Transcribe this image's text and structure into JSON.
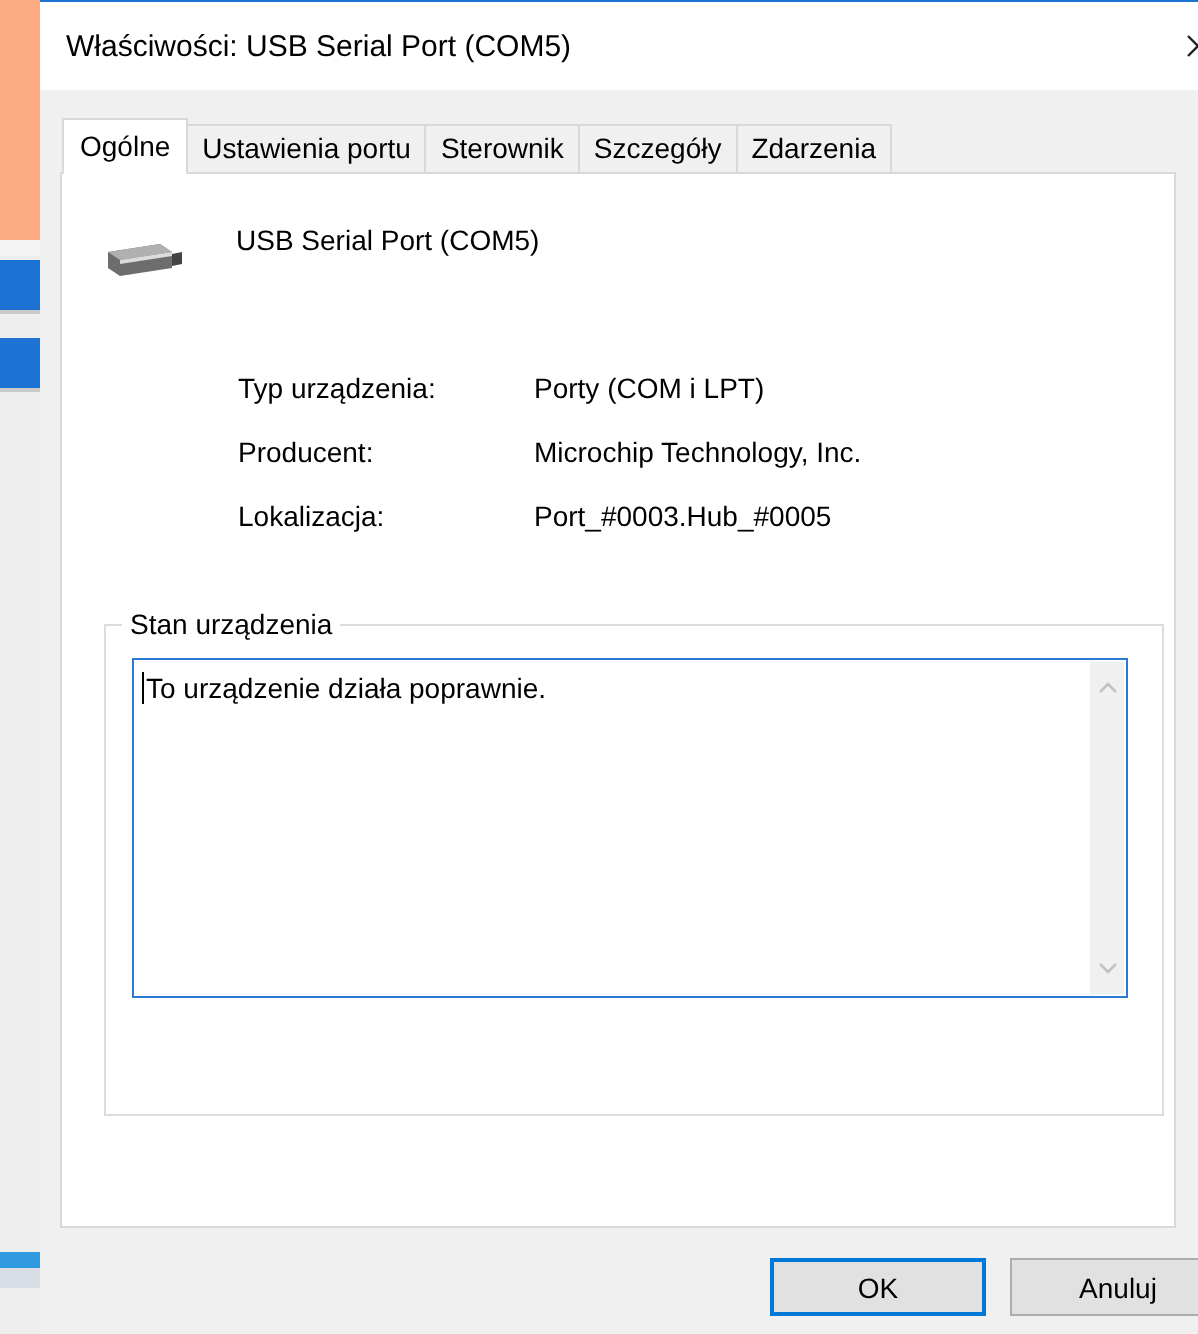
{
  "window": {
    "title": "Właściwości: USB Serial Port (COM5)"
  },
  "tabs": [
    {
      "label": "Ogólne",
      "selected": true
    },
    {
      "label": "Ustawienia portu",
      "selected": false
    },
    {
      "label": "Sterownik",
      "selected": false
    },
    {
      "label": "Szczegóły",
      "selected": false
    },
    {
      "label": "Zdarzenia",
      "selected": false
    }
  ],
  "device": {
    "name": "USB Serial Port (COM5)"
  },
  "properties": [
    {
      "label": "Typ urządzenia:",
      "value": "Porty (COM i LPT)"
    },
    {
      "label": "Producent:",
      "value": "Microchip Technology, Inc."
    },
    {
      "label": "Lokalizacja:",
      "value": "Port_#0003.Hub_#0005"
    }
  ],
  "status_group": {
    "title": "Stan urządzenia",
    "text": "To urządzenie działa poprawnie."
  },
  "buttons": [
    {
      "label": "OK",
      "default": true
    },
    {
      "label": "Anuluj",
      "default": false
    }
  ]
}
